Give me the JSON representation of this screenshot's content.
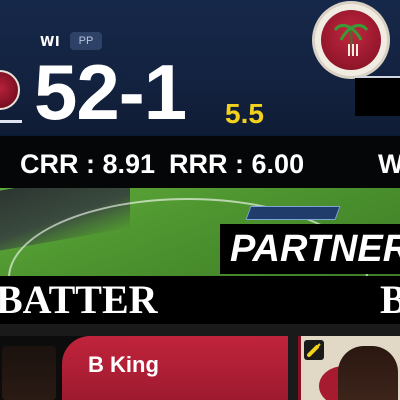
{
  "scoreboard": {
    "team_code": "WI",
    "phase_badge": "PP",
    "score": "52-1",
    "overs": "5.5",
    "crr": "CRR : 8.91",
    "rrr": "RRR : 6.00",
    "next_label_partial": "W"
  },
  "stadium": {
    "partnership_label": "PARTNER"
  },
  "headers": {
    "batter": "BATTER",
    "bowler_partial": "B"
  },
  "cards": {
    "batter_name": "B King"
  },
  "icons": [
    "team-badge-icon",
    "wi-logo-icon",
    "bat-icon"
  ],
  "colors": {
    "score_bg": "#13223f",
    "overs_yellow": "#f3d21d",
    "team_maroon": "#a61b30",
    "strip_black": "#050608"
  }
}
